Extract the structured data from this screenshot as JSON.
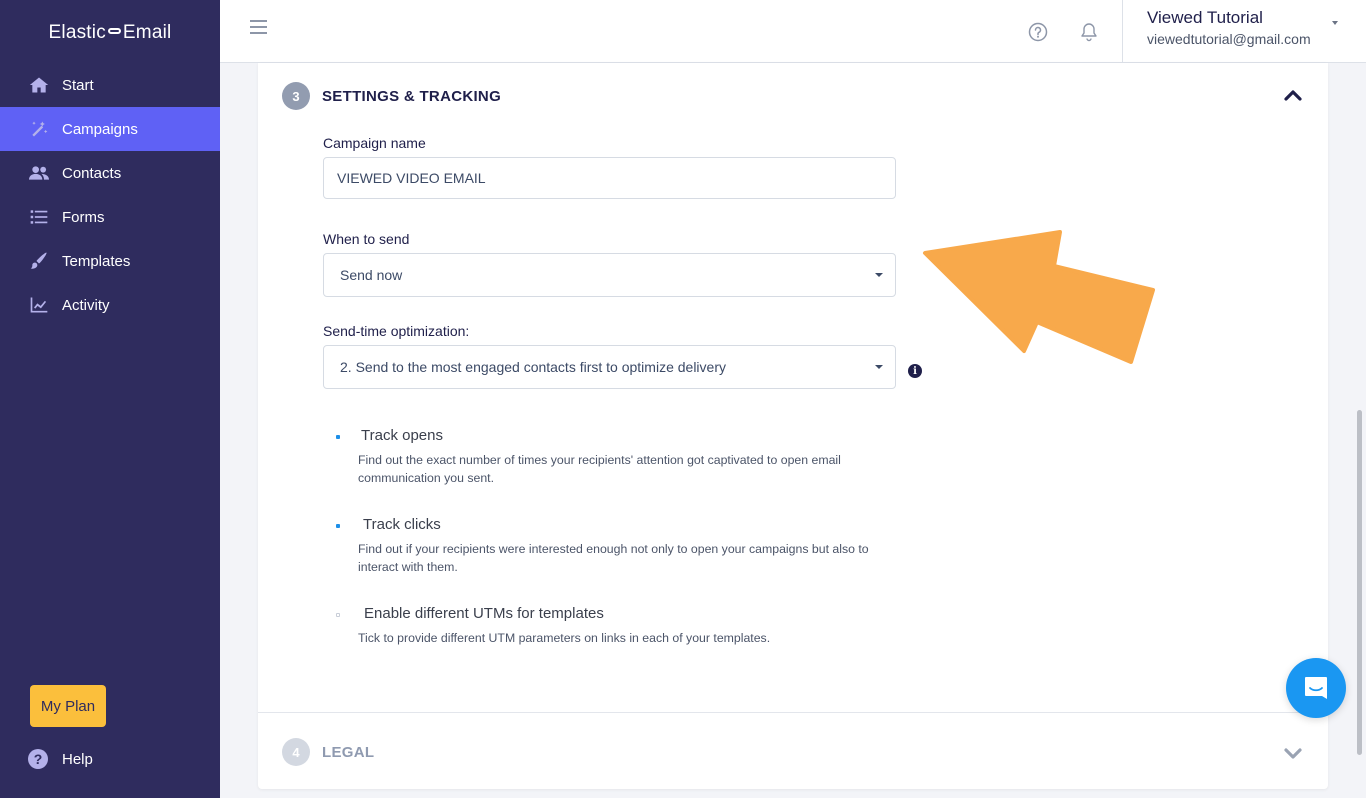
{
  "sidebar": {
    "logo_left": "Elastic",
    "logo_right": "Email",
    "items": [
      {
        "label": "Start",
        "icon": "home-icon",
        "active": false
      },
      {
        "label": "Campaigns",
        "icon": "magic-wand-icon",
        "active": true
      },
      {
        "label": "Contacts",
        "icon": "users-icon",
        "active": false
      },
      {
        "label": "Forms",
        "icon": "list-icon",
        "active": false
      },
      {
        "label": "Templates",
        "icon": "brush-icon",
        "active": false
      },
      {
        "label": "Activity",
        "icon": "chart-line-icon",
        "active": false
      }
    ],
    "my_plan_label": "My Plan",
    "help_label": "Help"
  },
  "header": {
    "user_name": "Viewed Tutorial",
    "user_email": "viewedtutorial@gmail.com"
  },
  "settings_section": {
    "step_number": "3",
    "title": "SETTINGS & TRACKING",
    "expanded": true,
    "campaign_name": {
      "label": "Campaign name",
      "value": "VIEWED VIDEO EMAIL"
    },
    "when_to_send": {
      "label": "When to send",
      "selected": "Send now"
    },
    "send_time_optimization": {
      "label": "Send-time optimization:",
      "selected": "2. Send to the most engaged contacts first to optimize delivery"
    },
    "options": [
      {
        "title": "Track opens",
        "description": "Find out the exact number of times your recipients' attention got captivated to open email communication you sent.",
        "checked": true
      },
      {
        "title": "Track clicks",
        "description": "Find out if your recipients were interested enough not only to open your campaigns but also to interact with them.",
        "checked": true
      },
      {
        "title": "Enable different UTMs for templates",
        "description": "Tick to provide different UTM parameters on links in each of your templates.",
        "checked": false
      }
    ]
  },
  "legal_section": {
    "step_number": "4",
    "title": "LEGAL",
    "expanded": false
  },
  "colors": {
    "sidebar_bg": "#2f2c5e",
    "active_nav": "#5f61f5",
    "my_plan": "#fbbf3c",
    "annotation_arrow": "#f8a94b",
    "chat_button": "#1a97f2",
    "checkbox_checked": "#1d8fe8"
  }
}
